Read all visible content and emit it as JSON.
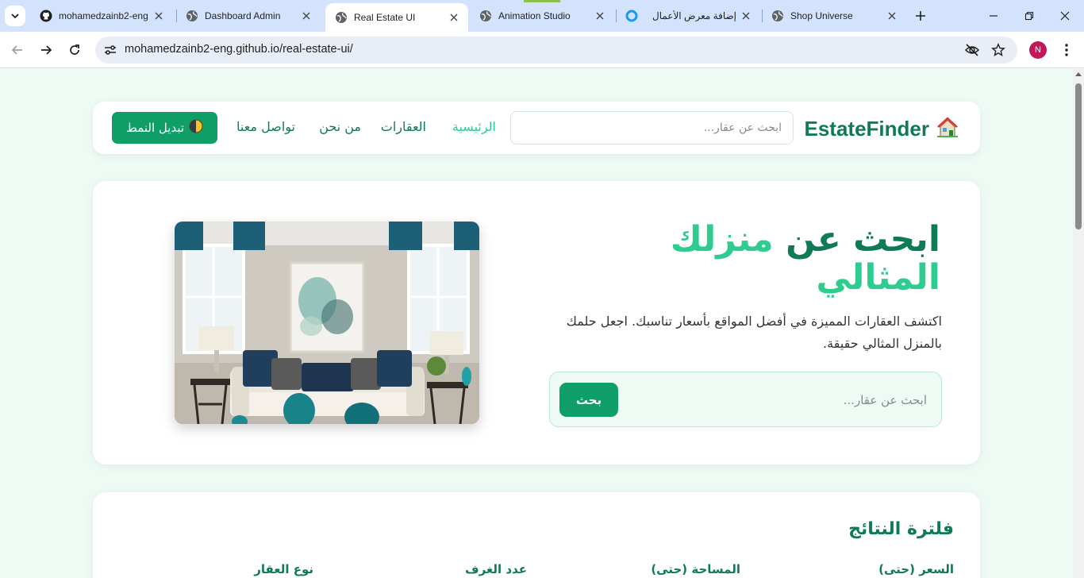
{
  "browser": {
    "tabs": [
      {
        "title": "mohamedzainb2-eng",
        "icon": "github-icon"
      },
      {
        "title": "Dashboard Admin",
        "icon": "globe-icon"
      },
      {
        "title": "Real Estate UI",
        "icon": "globe-icon",
        "active": true
      },
      {
        "title": "Animation Studio",
        "icon": "globe-icon"
      },
      {
        "title": "إضافة معرض الأعمال",
        "icon": "loading-icon"
      },
      {
        "title": "Shop Universe",
        "icon": "globe-icon"
      }
    ],
    "url": "mohamedzainb2-eng.github.io/real-estate-ui/",
    "profile_initial": "N"
  },
  "navbar": {
    "logo_text": "EstateFinder",
    "logo_icon": "house-icon",
    "search_placeholder": "ابحث عن عقار...",
    "links": [
      "الرئيسية",
      "العقارات",
      "من نحن",
      "تواصل معنا"
    ],
    "active_link": "الرئيسية",
    "toggle_label": "تبديل النمط",
    "toggle_icon": "half-moon-icon"
  },
  "hero": {
    "title_part1": "ابحث عن",
    "title_part2": "منزلك المثالي",
    "description": "اكتشف العقارات المميزة في أفضل المواقع بأسعار تناسبك. اجعل حلمك بالمنزل المثالي حقيقة.",
    "search_placeholder": "ابحث عن عقار...",
    "search_button": "بحث"
  },
  "filters": {
    "title": "فلترة النتائج",
    "labels": [
      "السعر (حتى)",
      "المساحة (حتى)",
      "عدد الغرف",
      "نوع العقار"
    ]
  },
  "colors": {
    "primary": "#0f7a56",
    "accent": "#2ecc8f",
    "button": "#0f9d68",
    "page_bg": "#eefaf4"
  }
}
